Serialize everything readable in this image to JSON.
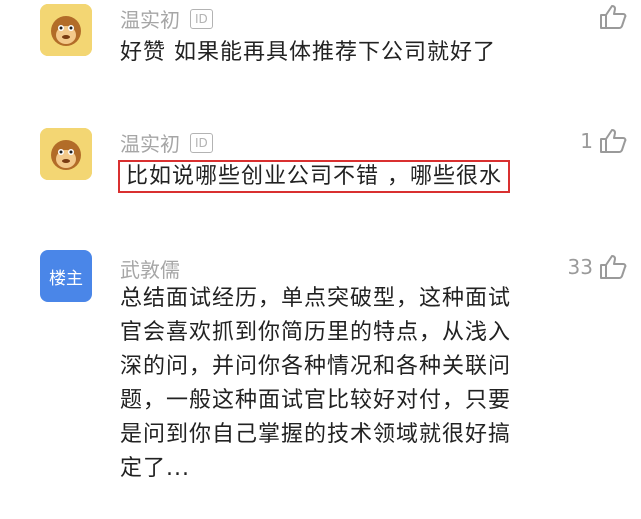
{
  "comments": [
    {
      "username": "温实初",
      "badge": "ID",
      "likes": "",
      "text": "好赞 如果能再具体推荐下公司就好了"
    },
    {
      "username": "温实初",
      "badge": "ID",
      "likes": "1",
      "text": "比如说哪些创业公司不错 ，哪些很水"
    },
    {
      "username": "武敦儒",
      "avatar_label": "楼主",
      "likes": "33",
      "text_lines": [
        "总结面试经历，单点突破型，这种面试",
        "官会喜欢抓到你简历里的特点，从浅入",
        "深的问，并问你各种情况和各种关联问",
        "题，一般这种面试官比较好对付，只要",
        "是问到你自己掌握的技术领域就很好搞",
        "定了..."
      ]
    }
  ],
  "colors": {
    "highlight_border": "#d93030",
    "owner_avatar": "#4a86e8",
    "monkey_avatar": "#f3d673"
  },
  "icons": {
    "like": "thumbs-up-icon",
    "avatar": "monkey-icon"
  }
}
